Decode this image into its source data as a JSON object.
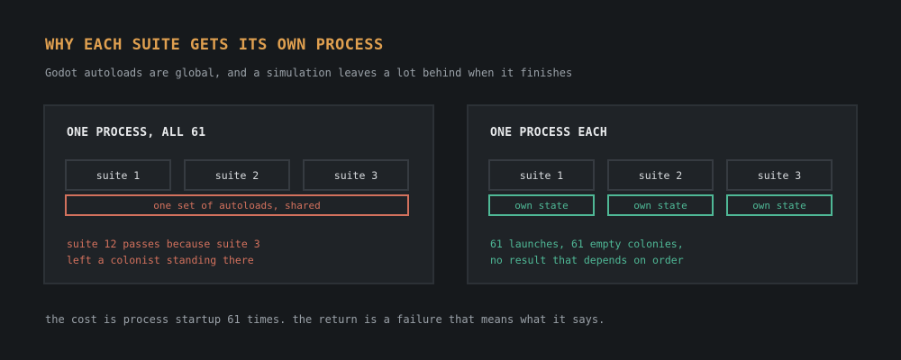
{
  "title": "WHY EACH SUITE GETS ITS OWN PROCESS",
  "subtitle": "Godot autoloads are global, and a simulation leaves a lot behind when it finishes",
  "left_panel": {
    "title": "ONE PROCESS, ALL 61",
    "suites": [
      "suite 1",
      "suite 2",
      "suite 3"
    ],
    "shared_label": "one set of autoloads, shared",
    "note_lines": [
      "suite 12 passes because suite 3",
      "left a colonist standing there"
    ]
  },
  "right_panel": {
    "title": "ONE PROCESS EACH",
    "suites": [
      "suite 1",
      "suite 2",
      "suite 3"
    ],
    "state_labels": [
      "own state",
      "own state",
      "own state"
    ],
    "note_lines": [
      "61 launches, 61 empty colonies,",
      "no result that depends on order"
    ]
  },
  "footer": "the cost is process startup 61 times. the return is a failure that means what it says.",
  "colors": {
    "title": "#e0a050",
    "shared_bad": "#d2715d",
    "own_good": "#4fb896",
    "background": "#16191c",
    "panel": "#1f2327"
  }
}
